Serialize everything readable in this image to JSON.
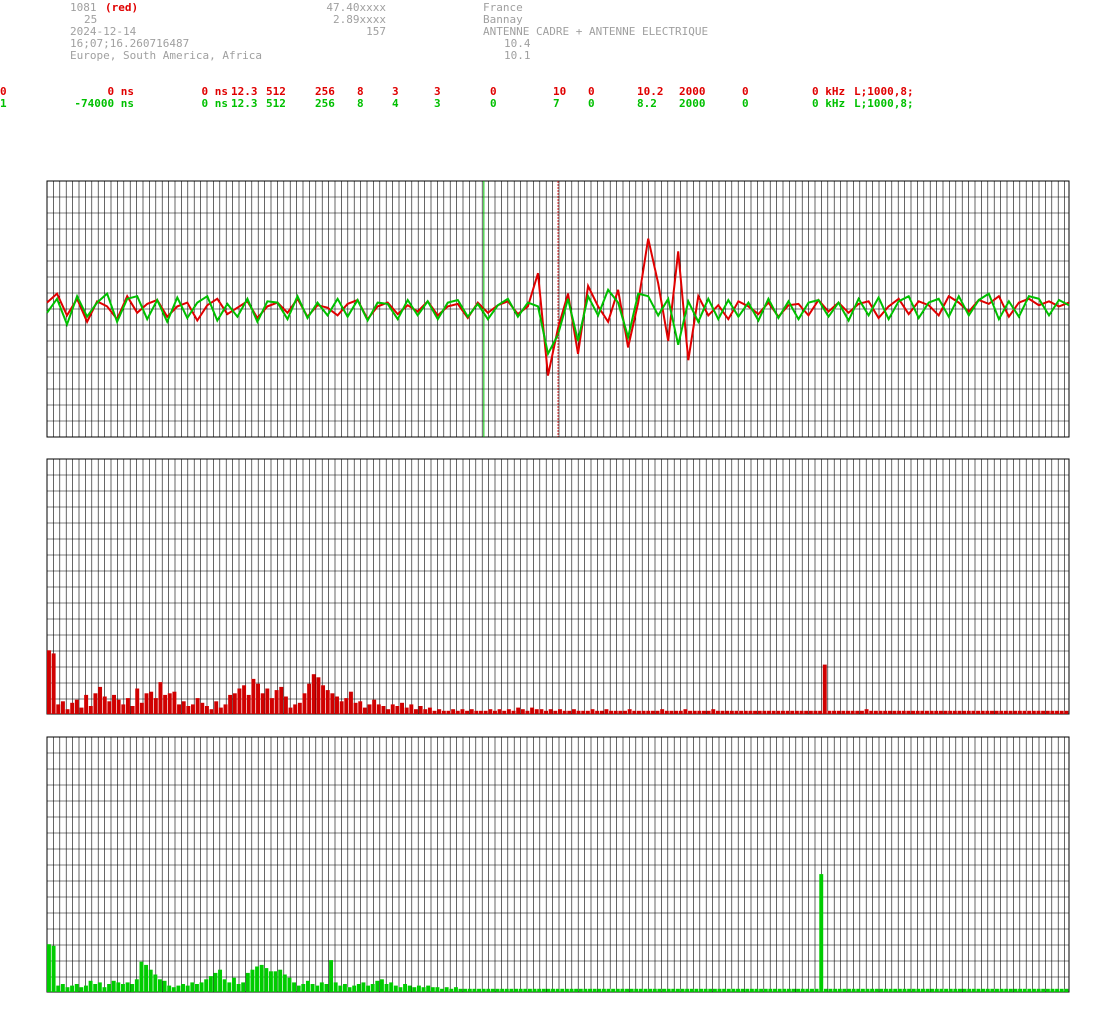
{
  "header": {
    "left": {
      "station_id": "1081",
      "color_tag": "(red)",
      "number": "25",
      "date": "2024-12-14",
      "time": "16;07;16.260716487",
      "regions": "Europe, South America, Africa"
    },
    "mid": {
      "latitude": "47.40xxxx",
      "longitude": "2.89xxxx",
      "altitude": "157"
    },
    "right": {
      "country": "France",
      "town": "Bannay",
      "antenna": "ANTENNE CADRE + ANTENNE ELECTRIQUE",
      "value1": "10.4",
      "value2": "10.1"
    }
  },
  "channels": [
    {
      "color": "#e00000",
      "cells": [
        "0",
        "0 ns",
        "0 ns",
        "12.3",
        "512",
        "256",
        "8",
        "3",
        "3",
        "0",
        "10",
        "0",
        "10.2",
        "2000",
        "0",
        "0 kHz",
        "L;1000,8;"
      ]
    },
    {
      "color": "#00c000",
      "cells": [
        "1",
        "-74000 ns",
        "0 ns",
        "12.3",
        "512",
        "256",
        "8",
        "4",
        "3",
        "0",
        "7",
        "0",
        "8.2",
        "2000",
        "0",
        "0 kHz",
        "L;1000,8;"
      ]
    }
  ],
  "chart_data": [
    {
      "type": "line",
      "x": [
        0,
        10,
        20,
        30,
        40,
        50,
        60,
        70,
        80,
        90,
        100,
        110,
        120,
        130,
        140,
        150,
        160,
        170,
        180,
        190,
        200,
        210,
        220,
        230,
        240,
        250,
        260,
        270,
        280,
        290,
        300,
        310,
        320,
        330,
        340,
        350,
        360,
        370,
        380,
        390,
        400,
        410,
        420,
        430,
        440,
        450,
        460,
        470,
        480,
        490,
        500,
        510,
        520,
        530,
        540,
        550,
        560,
        570,
        580,
        590,
        600,
        610,
        620,
        630,
        640,
        650,
        660,
        670,
        680,
        690,
        700,
        710,
        720,
        730,
        740,
        750,
        760,
        770,
        780,
        790,
        800,
        810,
        820,
        830,
        840,
        850,
        860,
        870,
        880,
        890,
        900,
        910,
        920,
        930,
        940,
        950,
        960,
        970,
        980,
        990,
        1000,
        1010,
        1020
      ],
      "ylim": [
        -1,
        1
      ],
      "grid": true,
      "markers": {
        "red_vline_x": 510,
        "green_vline_x": 436
      },
      "series": [
        {
          "color": "#e00000",
          "values": [
            0.05,
            0.12,
            -0.05,
            0.08,
            -0.1,
            0.06,
            0.02,
            -0.08,
            0.1,
            -0.03,
            0.04,
            0.07,
            -0.06,
            0.02,
            0.05,
            -0.09,
            0.03,
            0.08,
            -0.04,
            0.01,
            0.06,
            -0.07,
            0.02,
            0.05,
            -0.03,
            0.08,
            -0.06,
            0.03,
            0.01,
            -0.05,
            0.04,
            0.07,
            -0.08,
            0.02,
            0.05,
            -0.04,
            0.03,
            -0.02,
            0.06,
            -0.05,
            0.02,
            0.04,
            -0.07,
            0.05,
            -0.03,
            0.03,
            0.06,
            -0.04,
            0.02,
            0.28,
            -0.52,
            -0.15,
            0.12,
            -0.35,
            0.18,
            0.02,
            -0.1,
            0.15,
            -0.3,
            0.05,
            0.55,
            0.2,
            -0.25,
            0.45,
            -0.4,
            0.1,
            -0.05,
            0.03,
            -0.08,
            0.06,
            0.02,
            -0.04,
            0.05,
            -0.06,
            0.03,
            0.04,
            -0.05,
            0.07,
            -0.02,
            0.05,
            -0.03,
            0.04,
            0.06,
            -0.07,
            0.02,
            0.08,
            -0.04,
            0.06,
            0.03,
            -0.05,
            0.1,
            0.05,
            -0.02,
            0.07,
            0.04,
            0.1,
            -0.06,
            0.05,
            0.08,
            0.03,
            0.06,
            0.02,
            0.05
          ]
        },
        {
          "color": "#00c000",
          "values": [
            -0.03,
            0.08,
            -0.12,
            0.1,
            -0.06,
            0.05,
            0.12,
            -0.1,
            0.08,
            0.1,
            -0.08,
            0.07,
            -0.1,
            0.09,
            -0.07,
            0.05,
            0.1,
            -0.09,
            0.04,
            -0.06,
            0.08,
            -0.1,
            0.06,
            0.05,
            -0.08,
            0.1,
            -0.07,
            0.05,
            -0.05,
            0.08,
            -0.06,
            0.07,
            -0.09,
            0.05,
            0.04,
            -0.08,
            0.07,
            -0.05,
            0.06,
            -0.08,
            0.05,
            0.07,
            -0.06,
            0.04,
            -0.08,
            0.03,
            0.08,
            -0.06,
            0.05,
            0.02,
            -0.35,
            -0.2,
            0.08,
            -0.25,
            0.1,
            -0.05,
            0.15,
            0.05,
            -0.22,
            0.12,
            0.1,
            -0.05,
            0.08,
            -0.28,
            0.06,
            -0.1,
            0.08,
            -0.08,
            0.07,
            -0.06,
            0.05,
            -0.09,
            0.08,
            -0.07,
            0.06,
            -0.08,
            0.05,
            0.07,
            -0.06,
            0.05,
            -0.09,
            0.08,
            -0.05,
            0.09,
            -0.08,
            0.06,
            0.1,
            -0.07,
            0.05,
            0.08,
            -0.06,
            0.1,
            -0.05,
            0.07,
            0.12,
            -0.08,
            0.06,
            -0.06,
            0.1,
            0.08,
            -0.05,
            0.07,
            0.03
          ]
        }
      ]
    },
    {
      "type": "bar",
      "color": "#d00000",
      "ylim": [
        0,
        16
      ],
      "grid": true,
      "values": [
        4,
        3.8,
        0.6,
        0.8,
        0.3,
        0.7,
        0.9,
        0.4,
        1.2,
        0.5,
        1.3,
        1.7,
        1.1,
        0.8,
        1.2,
        0.9,
        0.6,
        1.0,
        0.5,
        1.6,
        0.7,
        1.3,
        1.4,
        1.0,
        2.0,
        1.2,
        1.3,
        1.4,
        0.6,
        0.8,
        0.5,
        0.6,
        1.0,
        0.7,
        0.5,
        0.3,
        0.8,
        0.4,
        0.6,
        1.2,
        1.3,
        1.6,
        1.8,
        1.2,
        2.2,
        1.9,
        1.3,
        1.6,
        1.0,
        1.5,
        1.7,
        1.1,
        0.4,
        0.6,
        0.7,
        1.3,
        1.9,
        2.5,
        2.3,
        1.8,
        1.5,
        1.3,
        1.1,
        0.8,
        1.0,
        1.4,
        0.7,
        0.8,
        0.4,
        0.6,
        0.9,
        0.6,
        0.5,
        0.3,
        0.6,
        0.5,
        0.7,
        0.4,
        0.6,
        0.3,
        0.5,
        0.3,
        0.4,
        0.2,
        0.3,
        0.2,
        0.2,
        0.3,
        0.2,
        0.3,
        0.2,
        0.3,
        0.2,
        0.2,
        0.2,
        0.3,
        0.2,
        0.3,
        0.2,
        0.3,
        0.2,
        0.4,
        0.3,
        0.2,
        0.4,
        0.3,
        0.3,
        0.2,
        0.3,
        0.2,
        0.3,
        0.2,
        0.2,
        0.3,
        0.2,
        0.2,
        0.2,
        0.3,
        0.2,
        0.2,
        0.3,
        0.2,
        0.2,
        0.2,
        0.2,
        0.3,
        0.2,
        0.2,
        0.2,
        0.2,
        0.2,
        0.2,
        0.3,
        0.2,
        0.2,
        0.2,
        0.2,
        0.3,
        0.2,
        0.2,
        0.2,
        0.2,
        0.2,
        0.3,
        0.2,
        0.2,
        0.2,
        0.2,
        0.2,
        0.2,
        0.2,
        0.2,
        0.2,
        0.2,
        0.2,
        0.2,
        0.2,
        0.2,
        0.2,
        0.2,
        0.2,
        0.2,
        0.2,
        0.2,
        0.2,
        0.2,
        0.2,
        0.2,
        0.2,
        0.2,
        0.2,
        0.2,
        0.2,
        0.2,
        0.2,
        0.2,
        0.3,
        0.2,
        0.2,
        0.2,
        0.2,
        0.2,
        0.2,
        0.2,
        0.2,
        0.2,
        0.2,
        0.2,
        0.2,
        0.2,
        0.2,
        0.2,
        0.2,
        0.2,
        0.2,
        0.2,
        0.2,
        0.2,
        0.2,
        0.2,
        0.2,
        0.2,
        0.2,
        0.2,
        0.2,
        0.2,
        0.2,
        0.2,
        0.2,
        0.2,
        0.2,
        0.2,
        0.2,
        0.2,
        0.2,
        0.2,
        0.2,
        0.2,
        0.2,
        0.2
      ],
      "peak": {
        "index": 167,
        "value": 3.1
      }
    },
    {
      "type": "bar",
      "color": "#00cc00",
      "ylim": [
        0,
        16
      ],
      "grid": true,
      "values": [
        3,
        2.9,
        0.4,
        0.5,
        0.3,
        0.4,
        0.5,
        0.3,
        0.4,
        0.7,
        0.5,
        0.6,
        0.3,
        0.5,
        0.7,
        0.6,
        0.5,
        0.6,
        0.5,
        0.8,
        1.9,
        1.7,
        1.4,
        1.1,
        0.8,
        0.7,
        0.4,
        0.3,
        0.4,
        0.5,
        0.4,
        0.6,
        0.5,
        0.6,
        0.8,
        1.0,
        1.2,
        1.4,
        0.8,
        0.6,
        0.9,
        0.5,
        0.6,
        1.2,
        1.4,
        1.6,
        1.7,
        1.5,
        1.3,
        1.3,
        1.4,
        1.1,
        0.9,
        0.6,
        0.4,
        0.5,
        0.7,
        0.5,
        0.4,
        0.6,
        0.5,
        2.0,
        0.6,
        0.4,
        0.5,
        0.3,
        0.4,
        0.5,
        0.6,
        0.4,
        0.5,
        0.7,
        0.8,
        0.5,
        0.6,
        0.4,
        0.3,
        0.5,
        0.4,
        0.3,
        0.4,
        0.3,
        0.4,
        0.3,
        0.3,
        0.2,
        0.3,
        0.2,
        0.3,
        0.2,
        0.2,
        0.2,
        0.2,
        0.2,
        0.2,
        0.2,
        0.2,
        0.2,
        0.2,
        0.2,
        0.2,
        0.2,
        0.2,
        0.2,
        0.2,
        0.2,
        0.2,
        0.2,
        0.2,
        0.2,
        0.2,
        0.2,
        0.2,
        0.2,
        0.2,
        0.2,
        0.2,
        0.2,
        0.2,
        0.2,
        0.2,
        0.2,
        0.2,
        0.2,
        0.2,
        0.2,
        0.2,
        0.2,
        0.2,
        0.2,
        0.2,
        0.2,
        0.2,
        0.2,
        0.2,
        0.2,
        0.2,
        0.2,
        0.2,
        0.2,
        0.2,
        0.2,
        0.2,
        0.2,
        0.2,
        0.2,
        0.2,
        0.2,
        0.2,
        0.2,
        0.2,
        0.2,
        0.2,
        0.2,
        0.2,
        0.2,
        0.2,
        0.2,
        0.2,
        0.2,
        0.2,
        0.2,
        0.2,
        0.2,
        0.2,
        0.2,
        0.2,
        0.2,
        0.2,
        0.2,
        0.2,
        0.2,
        0.2,
        0.2,
        0.2,
        0.2,
        0.2,
        0.2,
        0.2,
        0.2,
        0.2,
        0.2,
        0.2,
        0.2,
        0.2,
        0.2,
        0.2,
        0.2,
        0.2,
        0.2,
        0.2,
        0.2,
        0.2,
        0.2,
        0.2,
        0.2,
        0.2,
        0.2,
        0.2,
        0.2,
        0.2,
        0.2,
        0.2,
        0.2,
        0.2,
        0.2,
        0.2,
        0.2,
        0.2,
        0.2,
        0.2,
        0.2,
        0.2,
        0.2,
        0.2,
        0.2,
        0.2,
        0.2,
        0.2,
        0.2,
        0.2
      ],
      "peak": {
        "index": 167,
        "value": 7.4
      }
    }
  ]
}
